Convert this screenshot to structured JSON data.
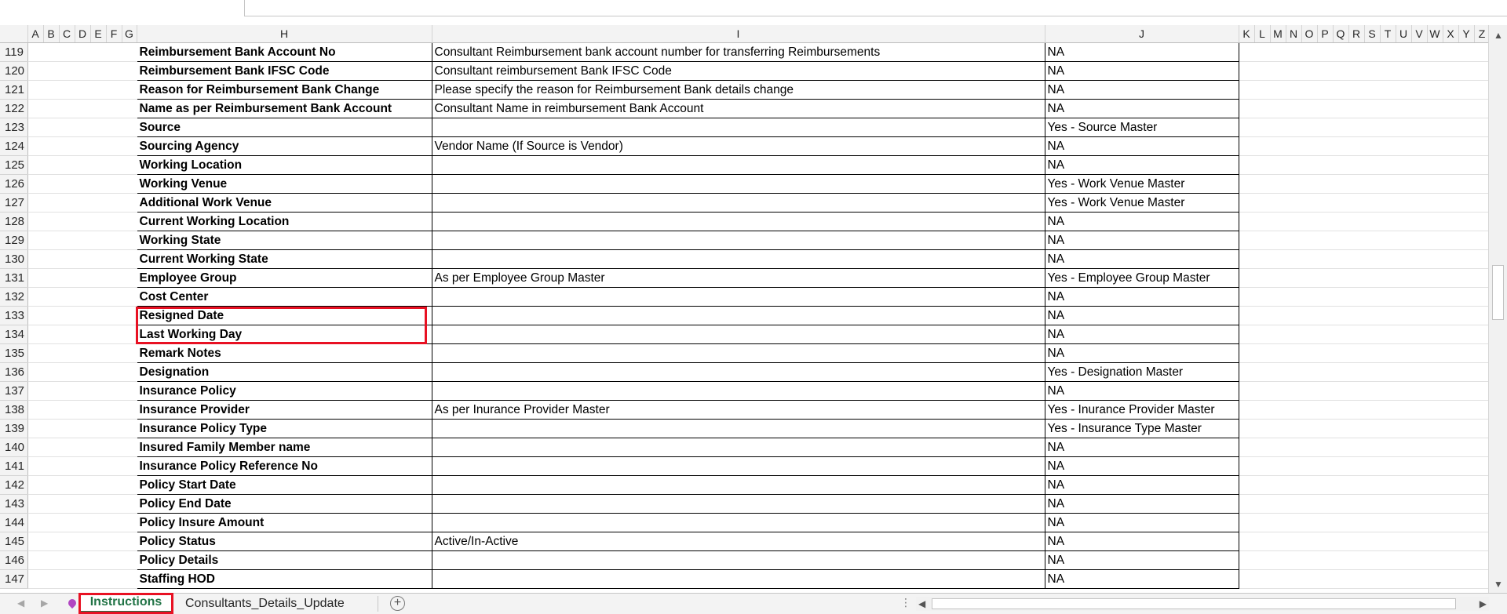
{
  "sheet": {
    "columns": [
      "A",
      "B",
      "C",
      "D",
      "E",
      "F",
      "G",
      "H",
      "I",
      "J",
      "K",
      "L",
      "M",
      "N",
      "O",
      "P",
      "Q",
      "R",
      "S",
      "T",
      "U",
      "V",
      "W",
      "X",
      "Y",
      "Z"
    ],
    "rows": [
      {
        "num": "119",
        "h": "Reimbursement Bank Account No",
        "i": "Consultant Reimbursement bank account number for transferring Reimbursements",
        "j": "NA"
      },
      {
        "num": "120",
        "h": "Reimbursement Bank IFSC Code",
        "i": "Consultant reimbursement Bank IFSC Code",
        "j": "NA"
      },
      {
        "num": "121",
        "h": "Reason for Reimbursement Bank Change",
        "i": "Please specify the reason for Reimbursement Bank details change",
        "j": "NA"
      },
      {
        "num": "122",
        "h": "Name as per Reimbursement Bank Account",
        "i": "Consultant Name in reimbursement Bank Account",
        "j": "NA"
      },
      {
        "num": "123",
        "h": "Source",
        "i": "",
        "j": "Yes - Source Master"
      },
      {
        "num": "124",
        "h": "Sourcing Agency",
        "i": "Vendor Name (If Source is Vendor)",
        "j": "NA"
      },
      {
        "num": "125",
        "h": "Working Location",
        "i": "",
        "j": "NA"
      },
      {
        "num": "126",
        "h": "Working Venue",
        "i": "",
        "j": "Yes - Work Venue Master"
      },
      {
        "num": "127",
        "h": "Additional Work Venue",
        "i": "",
        "j": "Yes - Work Venue Master"
      },
      {
        "num": "128",
        "h": "Current Working Location",
        "i": "",
        "j": "NA"
      },
      {
        "num": "129",
        "h": "Working State",
        "i": "",
        "j": "NA"
      },
      {
        "num": "130",
        "h": "Current Working State",
        "i": "",
        "j": "NA"
      },
      {
        "num": "131",
        "h": "Employee Group",
        "i": "As per Employee Group Master",
        "j": "Yes - Employee Group Master"
      },
      {
        "num": "132",
        "h": "Cost Center",
        "i": "",
        "j": "NA"
      },
      {
        "num": "133",
        "h": "Resigned Date",
        "i": "",
        "j": "NA"
      },
      {
        "num": "134",
        "h": "Last Working Day",
        "i": "",
        "j": "NA"
      },
      {
        "num": "135",
        "h": "Remark Notes",
        "i": "",
        "j": "NA"
      },
      {
        "num": "136",
        "h": "Designation",
        "i": "",
        "j": "Yes - Designation Master"
      },
      {
        "num": "137",
        "h": "Insurance Policy",
        "i": "",
        "j": "NA"
      },
      {
        "num": "138",
        "h": "Insurance Provider",
        "i": "As per Inurance Provider Master",
        "j": "Yes -  Inurance Provider Master"
      },
      {
        "num": "139",
        "h": "Insurance Policy Type",
        "i": "",
        "j": "Yes - Insurance Type Master"
      },
      {
        "num": "140",
        "h": "Insured Family Member name",
        "i": "",
        "j": "NA"
      },
      {
        "num": "141",
        "h": "Insurance Policy Reference No",
        "i": "",
        "j": "NA"
      },
      {
        "num": "142",
        "h": "Policy Start Date",
        "i": "",
        "j": "NA"
      },
      {
        "num": "143",
        "h": "Policy End Date",
        "i": "",
        "j": "NA"
      },
      {
        "num": "144",
        "h": "Policy Insure Amount",
        "i": "",
        "j": "NA"
      },
      {
        "num": "145",
        "h": "Policy Status",
        "i": "Active/In-Active",
        "j": "NA"
      },
      {
        "num": "146",
        "h": "Policy Details",
        "i": "",
        "j": "NA"
      },
      {
        "num": "147",
        "h": "Staffing HOD",
        "i": "",
        "j": "NA"
      }
    ]
  },
  "tabs": {
    "active": "Instructions",
    "other": "Consultants_Details_Update"
  },
  "colors": {
    "highlight": "#e81123",
    "active_tab_text": "#217346"
  }
}
